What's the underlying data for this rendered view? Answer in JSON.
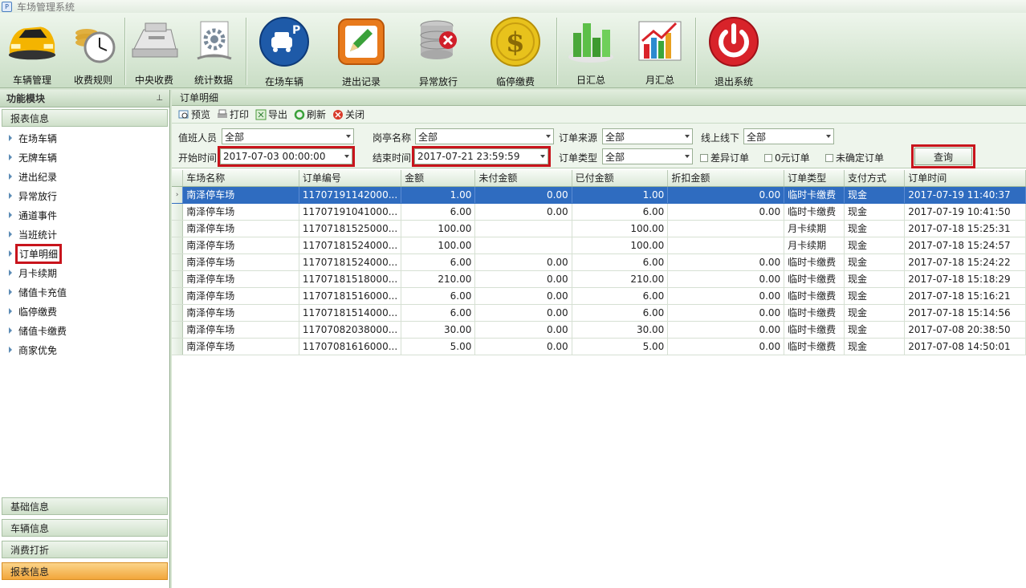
{
  "window": {
    "title": "车场管理系统"
  },
  "toolbar": [
    {
      "label": "车辆管理",
      "icon": "sports-car-icon"
    },
    {
      "label": "收费规则",
      "icon": "clock-coins-icon"
    },
    {
      "label": "中央收费",
      "icon": "cash-register-icon"
    },
    {
      "label": "统计数据",
      "icon": "gear-document-icon"
    },
    {
      "label": "在场车辆",
      "icon": "parking-car-icon"
    },
    {
      "label": "进出记录",
      "icon": "edit-pencil-icon"
    },
    {
      "label": "异常放行",
      "icon": "database-error-icon"
    },
    {
      "label": "临停缴费",
      "icon": "dollar-coin-icon"
    },
    {
      "label": "日汇总",
      "icon": "bar-chart-icon"
    },
    {
      "label": "月汇总",
      "icon": "trend-chart-icon"
    },
    {
      "label": "退出系统",
      "icon": "power-icon"
    }
  ],
  "sidebar": {
    "title": "功能模块",
    "pin": "⸏",
    "current_group": "报表信息",
    "items": [
      "在场车辆",
      "无牌车辆",
      "进出纪录",
      "异常放行",
      "通道事件",
      "当班统计",
      "订单明细",
      "月卡续期",
      "储值卡充值",
      "临停缴费",
      "储值卡缴费",
      "商家优免"
    ],
    "bottom_groups": [
      "基础信息",
      "车辆信息",
      "消费打折",
      "报表信息"
    ]
  },
  "main": {
    "tab_title": "订单明细",
    "actions": [
      "预览",
      "打印",
      "导出",
      "刷新",
      "关闭"
    ],
    "filters": {
      "duty_label": "值班人员",
      "duty_value": "全部",
      "booth_label": "岗亭名称",
      "booth_value": "全部",
      "source_label": "订单来源",
      "source_value": "全部",
      "online_label": "线上线下",
      "online_value": "全部",
      "start_label": "开始时间",
      "start_value": "2017-07-03 00:00:00",
      "end_label": "结束时间",
      "end_value": "2017-07-21 23:59:59",
      "type_label": "订单类型",
      "type_value": "全部",
      "cb_diff": "差异订单",
      "cb_zero": "0元订单",
      "cb_unconfirmed": "未确定订单",
      "query_button": "查询"
    },
    "columns": [
      "车场名称",
      "订单编号",
      "金额",
      "未付金额",
      "已付金额",
      "折扣金额",
      "订单类型",
      "支付方式",
      "订单时间"
    ],
    "rows": [
      [
        "南泽停车场",
        "11707191142000...",
        "1.00",
        "0.00",
        "1.00",
        "0.00",
        "临时卡缴费",
        "现金",
        "2017-07-19 11:40:37"
      ],
      [
        "南泽停车场",
        "11707191041000...",
        "6.00",
        "0.00",
        "6.00",
        "0.00",
        "临时卡缴费",
        "现金",
        "2017-07-19 10:41:50"
      ],
      [
        "南泽停车场",
        "11707181525000...",
        "100.00",
        "",
        "100.00",
        "",
        "月卡续期",
        "现金",
        "2017-07-18 15:25:31"
      ],
      [
        "南泽停车场",
        "11707181524000...",
        "100.00",
        "",
        "100.00",
        "",
        "月卡续期",
        "现金",
        "2017-07-18 15:24:57"
      ],
      [
        "南泽停车场",
        "11707181524000...",
        "6.00",
        "0.00",
        "6.00",
        "0.00",
        "临时卡缴费",
        "现金",
        "2017-07-18 15:24:22"
      ],
      [
        "南泽停车场",
        "11707181518000...",
        "210.00",
        "0.00",
        "210.00",
        "0.00",
        "临时卡缴费",
        "现金",
        "2017-07-18 15:18:29"
      ],
      [
        "南泽停车场",
        "11707181516000...",
        "6.00",
        "0.00",
        "6.00",
        "0.00",
        "临时卡缴费",
        "现金",
        "2017-07-18 15:16:21"
      ],
      [
        "南泽停车场",
        "11707181514000...",
        "6.00",
        "0.00",
        "6.00",
        "0.00",
        "临时卡缴费",
        "现金",
        "2017-07-18 15:14:56"
      ],
      [
        "南泽停车场",
        "11707082038000...",
        "30.00",
        "0.00",
        "30.00",
        "0.00",
        "临时卡缴费",
        "现金",
        "2017-07-08 20:38:50"
      ],
      [
        "南泽停车场",
        "11707081616000...",
        "5.00",
        "0.00",
        "5.00",
        "0.00",
        "临时卡缴费",
        "现金",
        "2017-07-08 14:50:01"
      ]
    ],
    "selected_row": 0
  },
  "colors": {
    "highlight_box": "#c8141c",
    "selection": "#2f6cc0",
    "active_group": "#f2a63b"
  }
}
